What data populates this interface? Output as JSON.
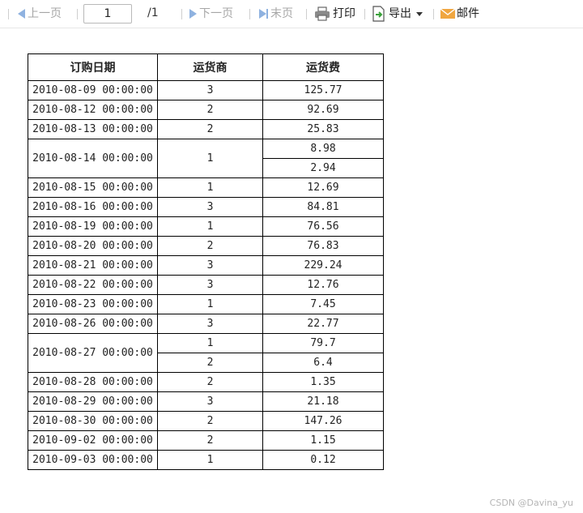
{
  "toolbar": {
    "first_label": "上一页",
    "page_value": "1",
    "page_total": "/1",
    "next_label": "下一页",
    "last_label": "末页",
    "print_label": "打印",
    "export_label": "导出",
    "mail_label": "邮件"
  },
  "table": {
    "headers": [
      "订购日期",
      "运货商",
      "运货费"
    ],
    "rows": [
      {
        "date": "2010-08-09 00:00:00",
        "items": [
          {
            "carrier": "3",
            "fee": "125.77"
          }
        ]
      },
      {
        "date": "2010-08-12 00:00:00",
        "items": [
          {
            "carrier": "2",
            "fee": "92.69"
          }
        ]
      },
      {
        "date": "2010-08-13 00:00:00",
        "items": [
          {
            "carrier": "2",
            "fee": "25.83"
          }
        ]
      },
      {
        "date": "2010-08-14 00:00:00",
        "carrier": "1",
        "items": [
          {
            "fee": "8.98"
          },
          {
            "fee": "2.94"
          }
        ]
      },
      {
        "date": "2010-08-15 00:00:00",
        "items": [
          {
            "carrier": "1",
            "fee": "12.69"
          }
        ]
      },
      {
        "date": "2010-08-16 00:00:00",
        "items": [
          {
            "carrier": "3",
            "fee": "84.81"
          }
        ]
      },
      {
        "date": "2010-08-19 00:00:00",
        "items": [
          {
            "carrier": "1",
            "fee": "76.56"
          }
        ]
      },
      {
        "date": "2010-08-20 00:00:00",
        "items": [
          {
            "carrier": "2",
            "fee": "76.83"
          }
        ]
      },
      {
        "date": "2010-08-21 00:00:00",
        "items": [
          {
            "carrier": "3",
            "fee": "229.24"
          }
        ]
      },
      {
        "date": "2010-08-22 00:00:00",
        "items": [
          {
            "carrier": "3",
            "fee": "12.76"
          }
        ]
      },
      {
        "date": "2010-08-23 00:00:00",
        "items": [
          {
            "carrier": "1",
            "fee": "7.45"
          }
        ]
      },
      {
        "date": "2010-08-26 00:00:00",
        "items": [
          {
            "carrier": "3",
            "fee": "22.77"
          }
        ]
      },
      {
        "date": "2010-08-27 00:00:00",
        "items": [
          {
            "carrier": "1",
            "fee": "79.7"
          },
          {
            "carrier": "2",
            "fee": "6.4"
          }
        ]
      },
      {
        "date": "2010-08-28 00:00:00",
        "items": [
          {
            "carrier": "2",
            "fee": "1.35"
          }
        ]
      },
      {
        "date": "2010-08-29 00:00:00",
        "items": [
          {
            "carrier": "3",
            "fee": "21.18"
          }
        ]
      },
      {
        "date": "2010-08-30 00:00:00",
        "items": [
          {
            "carrier": "2",
            "fee": "147.26"
          }
        ]
      },
      {
        "date": "2010-09-02 00:00:00",
        "items": [
          {
            "carrier": "2",
            "fee": "1.15"
          }
        ]
      },
      {
        "date": "2010-09-03 00:00:00",
        "items": [
          {
            "carrier": "1",
            "fee": "0.12"
          }
        ]
      }
    ]
  },
  "watermark": "CSDN @Davina_yu",
  "colors": {
    "nav_icon": "#8fb2e0",
    "disabled_text": "#a6a6a6",
    "export_icon": "#3aa23a",
    "mail_icon": "#f0a640"
  },
  "icons": [
    "prev-page-icon",
    "next-page-icon",
    "last-page-icon",
    "printer-icon",
    "export-icon",
    "mail-icon"
  ]
}
